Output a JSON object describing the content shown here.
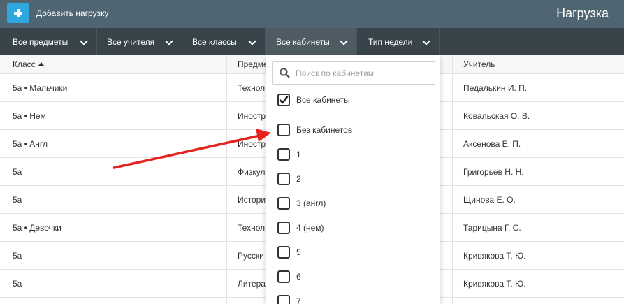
{
  "header": {
    "add_label": "Добавить нагрузку",
    "title": "Нагрузка"
  },
  "filters": [
    {
      "label": "Все предметы"
    },
    {
      "label": "Все учителя"
    },
    {
      "label": "Все классы"
    },
    {
      "label": "Все кабинеты",
      "active": true
    },
    {
      "label": "Тип недели"
    }
  ],
  "table": {
    "columns": [
      "Класс",
      "Предме",
      "Учитель"
    ],
    "sort_column": "Класс",
    "rows": [
      {
        "klass": "5а • Мальчики",
        "subject": "Технол",
        "teacher": "Педалькин И. П."
      },
      {
        "klass": "5а • Нем",
        "subject": "Иностр",
        "teacher": "Ковальская О. В."
      },
      {
        "klass": "5а • Англ",
        "subject": "Иностр",
        "teacher": "Аксенова Е. П."
      },
      {
        "klass": "5а",
        "subject": "Физкул",
        "teacher": "Григорьев Н. Н."
      },
      {
        "klass": "5а",
        "subject": "Истори",
        "teacher": "Щинова Е. О."
      },
      {
        "klass": "5а • Девочки",
        "subject": "Технол",
        "teacher": "Тарицына Г. С."
      },
      {
        "klass": "5а",
        "subject": "Русски",
        "teacher": "Кривякова Т. Ю."
      },
      {
        "klass": "5а",
        "subject": "Литера",
        "teacher": "Кривякова Т. Ю."
      }
    ]
  },
  "dropdown": {
    "search_placeholder": "Поиск по кабинетам",
    "all_label": "Все кабинеты",
    "all_checked": true,
    "options": [
      "Без кабинетов",
      "1",
      "2",
      "3 (англ)",
      "4 (нем)",
      "5",
      "6",
      "7"
    ]
  },
  "colors": {
    "topbar": "#4f6571",
    "filterbar": "#38434a",
    "accent": "#2ea8df",
    "arrow": "#e52420"
  }
}
